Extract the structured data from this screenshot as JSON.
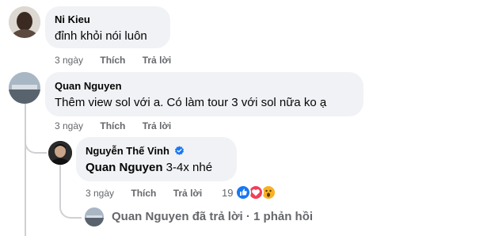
{
  "comments": [
    {
      "author": "Ni Kieu",
      "text": "đỉnh khỏi nói luôn",
      "time": "3 ngày",
      "like_label": "Thích",
      "reply_label": "Trả lời"
    },
    {
      "author": "Quan Nguyen",
      "text": "Thêm view sol với a. Có làm tour 3 với sol nữa ko ạ",
      "time": "3 ngày",
      "like_label": "Thích",
      "reply_label": "Trả lời",
      "reply": {
        "author": "Nguyễn Thế Vinh",
        "verified": true,
        "mention": "Quan Nguyen",
        "text": " 3-4x nhé",
        "time": "3 ngày",
        "like_label": "Thích",
        "reply_label": "Trả lời",
        "reaction_count": "19",
        "reactions": [
          "like-icon",
          "love-icon",
          "wow-icon"
        ],
        "colors": {
          "like": "#1877f2",
          "love": "#f33e58",
          "wow": "#f7b125"
        }
      },
      "more_replies": {
        "author": "Quan Nguyen",
        "text": "đã trả lời",
        "separator": "·",
        "count_text": "1 phản hồi"
      }
    }
  ]
}
